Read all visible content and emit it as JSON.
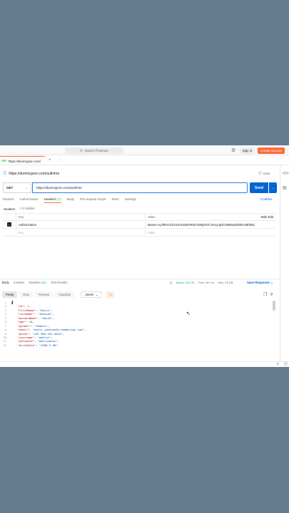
{
  "topbar": {
    "search_placeholder": "Search Postman",
    "sign_in_label": "Sign In",
    "create_account_label": "Create Account"
  },
  "tab": {
    "method": "GET",
    "title": "https://dummyjson.com/"
  },
  "request": {
    "title": "https://dummyjson.com/auth/me",
    "save_label": "Save",
    "method": "GET",
    "url": "https://dummyjson.com/auth/me",
    "send_label": "Send",
    "tabs": [
      {
        "label": "Params",
        "count": ""
      },
      {
        "label": "Authorization",
        "count": ""
      },
      {
        "label": "Headers",
        "count": "(7)"
      },
      {
        "label": "Body",
        "count": ""
      },
      {
        "label": "Pre-request Script",
        "count": ""
      },
      {
        "label": "Tests",
        "count": ""
      },
      {
        "label": "Settings",
        "count": ""
      }
    ],
    "cookies_label": "Cookies"
  },
  "headers_panel": {
    "title": "Headers",
    "hidden_label": "6 hidden",
    "col_key": "Key",
    "col_value": "Value",
    "bulk_edit": "Bulk Edit",
    "rows": [
      {
        "key": "Authorization",
        "value": "Bearer eyJhbGciOiJIUzI1NiIsInR5cCI6IkpXVCJ9.eyJpZCI6MSwidXNlcm5hbW..."
      }
    ],
    "placeholder_key": "Key",
    "placeholder_value": "Value"
  },
  "response": {
    "tabs": [
      {
        "label": "Body",
        "count": ""
      },
      {
        "label": "Cookies",
        "count": ""
      },
      {
        "label": "Headers",
        "count": "(11)"
      },
      {
        "label": "Test Results",
        "count": ""
      }
    ],
    "status": "Status: 200 OK",
    "time": "Time: 297 ms",
    "size": "Size: 2.5 KB",
    "save_response": "Save Response",
    "view_buttons": [
      "Pretty",
      "Raw",
      "Preview",
      "Visualize"
    ],
    "format": "JSON",
    "lines": [
      "{",
      "    \"id\": 1,",
      "    \"firstName\": \"Emily\",",
      "    \"lastName\": \"Johnson\",",
      "    \"maidenName\": \"Smith\",",
      "    \"age\": 28,",
      "    \"gender\": \"female\",",
      "    \"email\": \"emily.johnson@x.dummyjson.com\",",
      "    \"phone\": \"+81 965-431-3024\",",
      "    \"username\": \"emilys\",",
      "    \"password\": \"emilyspass\",",
      "    \"birthDate\": \"1996-5-30\","
    ]
  },
  "colors": {
    "accent": "#ff6c37",
    "send": "#0265d2",
    "success": "#0cbb52"
  }
}
